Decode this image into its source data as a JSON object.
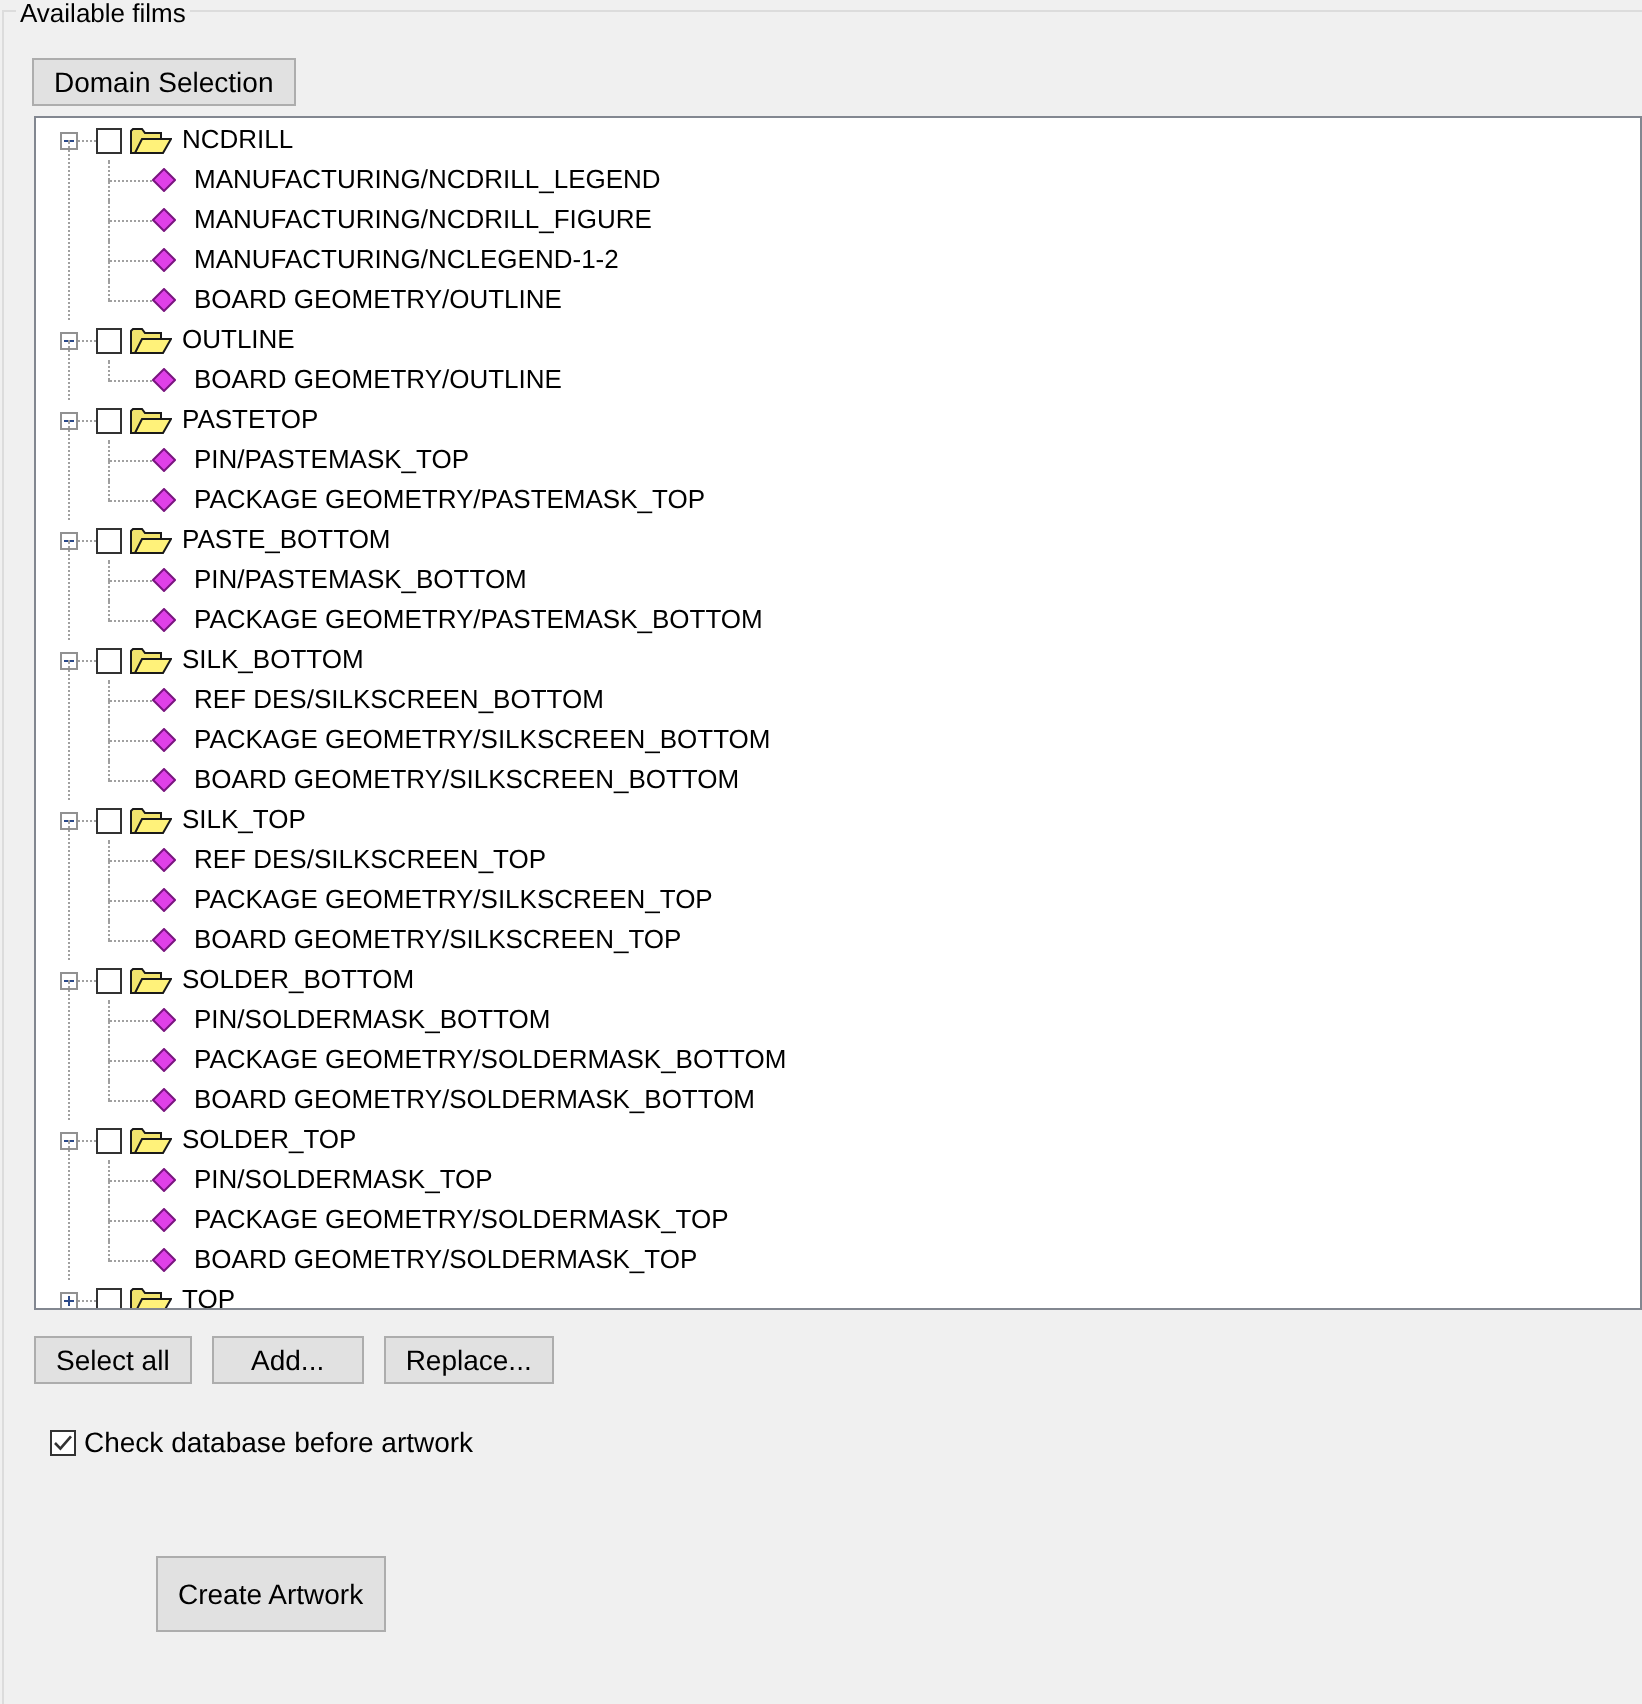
{
  "group_box": {
    "title": "Available films"
  },
  "domain_button": "Domain Selection",
  "tree": [
    {
      "label": "NCDRILL",
      "expanded": true,
      "checked": false,
      "children": [
        {
          "label": "MANUFACTURING/NCDRILL_LEGEND"
        },
        {
          "label": "MANUFACTURING/NCDRILL_FIGURE"
        },
        {
          "label": "MANUFACTURING/NCLEGEND-1-2"
        },
        {
          "label": "BOARD GEOMETRY/OUTLINE"
        }
      ]
    },
    {
      "label": "OUTLINE",
      "expanded": true,
      "checked": false,
      "children": [
        {
          "label": "BOARD GEOMETRY/OUTLINE"
        }
      ]
    },
    {
      "label": "PASTETOP",
      "expanded": true,
      "checked": false,
      "children": [
        {
          "label": "PIN/PASTEMASK_TOP"
        },
        {
          "label": "PACKAGE GEOMETRY/PASTEMASK_TOP"
        }
      ]
    },
    {
      "label": "PASTE_BOTTOM",
      "expanded": true,
      "checked": false,
      "children": [
        {
          "label": "PIN/PASTEMASK_BOTTOM"
        },
        {
          "label": "PACKAGE GEOMETRY/PASTEMASK_BOTTOM"
        }
      ]
    },
    {
      "label": "SILK_BOTTOM",
      "expanded": true,
      "checked": false,
      "children": [
        {
          "label": "REF DES/SILKSCREEN_BOTTOM"
        },
        {
          "label": "PACKAGE GEOMETRY/SILKSCREEN_BOTTOM"
        },
        {
          "label": "BOARD GEOMETRY/SILKSCREEN_BOTTOM"
        }
      ]
    },
    {
      "label": "SILK_TOP",
      "expanded": true,
      "checked": false,
      "children": [
        {
          "label": "REF DES/SILKSCREEN_TOP"
        },
        {
          "label": "PACKAGE GEOMETRY/SILKSCREEN_TOP"
        },
        {
          "label": "BOARD GEOMETRY/SILKSCREEN_TOP"
        }
      ]
    },
    {
      "label": "SOLDER_BOTTOM",
      "expanded": true,
      "checked": false,
      "children": [
        {
          "label": "PIN/SOLDERMASK_BOTTOM"
        },
        {
          "label": "PACKAGE GEOMETRY/SOLDERMASK_BOTTOM"
        },
        {
          "label": "BOARD GEOMETRY/SOLDERMASK_BOTTOM"
        }
      ]
    },
    {
      "label": "SOLDER_TOP",
      "expanded": true,
      "checked": false,
      "children": [
        {
          "label": "PIN/SOLDERMASK_TOP"
        },
        {
          "label": "PACKAGE GEOMETRY/SOLDERMASK_TOP"
        },
        {
          "label": "BOARD GEOMETRY/SOLDERMASK_TOP"
        }
      ]
    },
    {
      "label": "TOP",
      "expanded": false,
      "checked": false
    }
  ],
  "list_buttons": [
    "Select all",
    "Add...",
    "Replace..."
  ],
  "check_database": {
    "label": "Check database before artwork",
    "checked": true
  },
  "create_button": "Create Artwork"
}
